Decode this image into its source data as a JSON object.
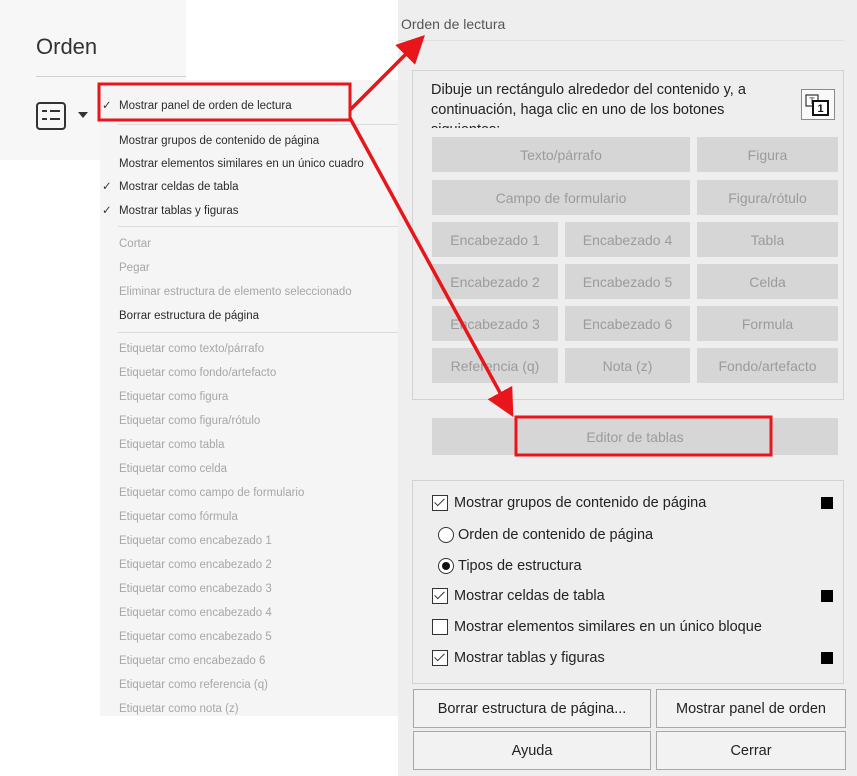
{
  "orden": {
    "title": "Orden"
  },
  "context_menu": {
    "items": [
      {
        "label": "Mostrar panel de orden de lectura",
        "checked": true
      },
      {
        "label": "Mostrar grupos de contenido de página",
        "checked": false
      },
      {
        "label": "Mostrar elementos similares en un único cuadro",
        "checked": false
      },
      {
        "label": "Mostrar celdas de tabla",
        "checked": true
      },
      {
        "label": "Mostrar tablas y figuras",
        "checked": true
      },
      {
        "label": "Cortar",
        "checked": false
      },
      {
        "label": "Pegar",
        "checked": false
      },
      {
        "label": "Eliminar estructura de elemento seleccionado",
        "checked": false
      },
      {
        "label": "Borrar estructura de página",
        "checked": false
      },
      {
        "label": "Etiquetar como texto/párrafo",
        "checked": false
      },
      {
        "label": "Etiquetar como fondo/artefacto",
        "checked": false
      },
      {
        "label": "Etiquetar como figura",
        "checked": false
      },
      {
        "label": "Etiquetar como figura/rótulo",
        "checked": false
      },
      {
        "label": "Etiquetar como tabla",
        "checked": false
      },
      {
        "label": "Etiquetar como celda",
        "checked": false
      },
      {
        "label": "Etiquetar como campo de formulario",
        "checked": false
      },
      {
        "label": "Etiquetar como fórmula",
        "checked": false
      },
      {
        "label": "Etiquetar como encabezado 1",
        "checked": false
      },
      {
        "label": "Etiquetar como encabezado 2",
        "checked": false
      },
      {
        "label": "Etiquetar como encabezado 3",
        "checked": false
      },
      {
        "label": "Etiquetar como encabezado 4",
        "checked": false
      },
      {
        "label": "Etiquetar como encabezado 5",
        "checked": false
      },
      {
        "label": "Etiquetar cmo encabezado 6",
        "checked": false
      },
      {
        "label": "Etiquetar como referencia (q)",
        "checked": false
      },
      {
        "label": "Etiquetar como nota (z)",
        "checked": false
      }
    ]
  },
  "dialog": {
    "title": "Orden de lectura",
    "instructions": "Dibuje un rectángulo alrededor del contenido y, a continuación, haga clic en uno de los botones siguientes:",
    "tag_buttons": [
      "Texto/párrafo",
      "Figura",
      "Campo de formulario",
      "Figura/rótulo",
      "Encabezado 1",
      "Encabezado 4",
      "Tabla",
      "Encabezado 2",
      "Encabezado 5",
      "Celda",
      "Encabezado 3",
      "Encabezado 6",
      "Formula",
      "Referencia (q)",
      "Nota (z)",
      "Fondo/artefacto"
    ],
    "table_editor": "Editor de tablas",
    "options": {
      "show_page_groups": "Mostrar grupos de contenido de página",
      "page_content_order": "Orden de contenido de página",
      "structure_types": "Tipos de estructura",
      "show_table_cells": "Mostrar celdas de tabla",
      "show_similar_elements": "Mostrar elementos similares en un único bloque",
      "show_tables_figures": "Mostrar tablas y figuras"
    },
    "buttons": {
      "clear_structure": "Borrar estructura de página...",
      "show_order_panel": "Mostrar panel de orden",
      "help": "Ayuda",
      "close": "Cerrar"
    }
  },
  "colors": {
    "highlight": "#e8161b",
    "disabled_button": "#d6d6d6"
  }
}
